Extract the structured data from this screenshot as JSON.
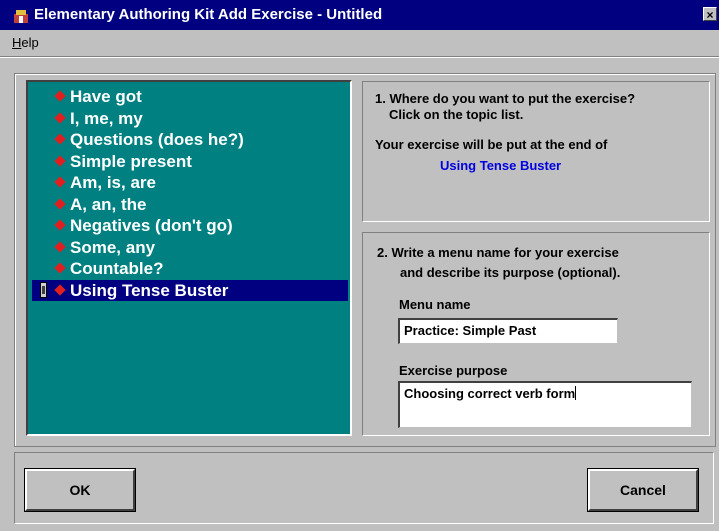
{
  "window": {
    "title": "Elementary Authoring Kit Add Exercise - Untitled",
    "close_glyph": "×"
  },
  "menu": {
    "help_mnemonic": "H",
    "help_rest": "elp"
  },
  "topics": [
    {
      "label": "Have got",
      "selected": false
    },
    {
      "label": "I, me, my",
      "selected": false
    },
    {
      "label": "Questions (does he?)",
      "selected": false
    },
    {
      "label": "Simple present",
      "selected": false
    },
    {
      "label": "Am, is, are",
      "selected": false
    },
    {
      "label": "A, an, the",
      "selected": false
    },
    {
      "label": "Negatives (don't go)",
      "selected": false
    },
    {
      "label": "Some, any",
      "selected": false
    },
    {
      "label": "Countable?",
      "selected": false
    },
    {
      "label": "Using Tense Buster",
      "selected": true
    }
  ],
  "step1": {
    "line1": "1. Where do you want to put the exercise?",
    "line2": "Click on the topic list.",
    "line3": "Your exercise will be put at the end of",
    "target_topic": "Using Tense Buster"
  },
  "step2": {
    "line1": "2. Write a menu name for your exercise",
    "line2": "and describe its purpose (optional).",
    "menu_name_label": "Menu name",
    "menu_name_value": "Practice: Simple Past",
    "purpose_label": "Exercise purpose",
    "purpose_value": "Choosing correct verb form"
  },
  "buttons": {
    "ok": "OK",
    "cancel": "Cancel"
  },
  "colors": {
    "titlebar": "#000080",
    "list_bg": "#008080",
    "bullet": "#e02020",
    "link": "#0000e0",
    "face": "#c0c0c0"
  },
  "icons": {
    "title": "app-icon",
    "close": "close-icon",
    "bullet": "diamond-bullet-icon",
    "pen": "pen-icon"
  }
}
